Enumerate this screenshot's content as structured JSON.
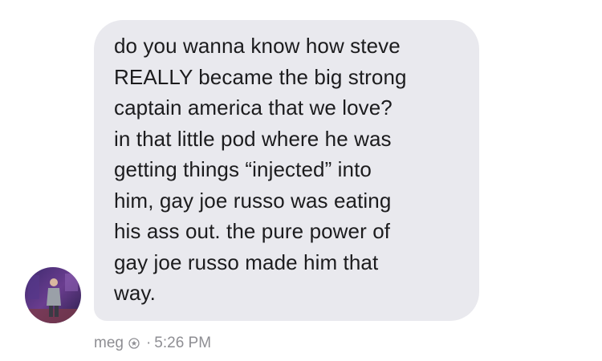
{
  "message": {
    "lines": [
      "do you wanna know how steve",
      "REALLY became the big strong",
      "captain america that we love?",
      "in that little pod where he was",
      "getting things “injected” into",
      "him, gay joe russo was eating",
      "his ass out. the pure power of",
      "gay joe russo made him that",
      "way."
    ],
    "sender": "meg",
    "separator": "·",
    "time": "5:26 PM",
    "badge_icon": "verified-badge-icon",
    "avatar_icon": "person-photo-avatar"
  },
  "colors": {
    "bubble": "#e9e9ee",
    "text": "#1c1c1e",
    "meta": "#8e8e93"
  }
}
